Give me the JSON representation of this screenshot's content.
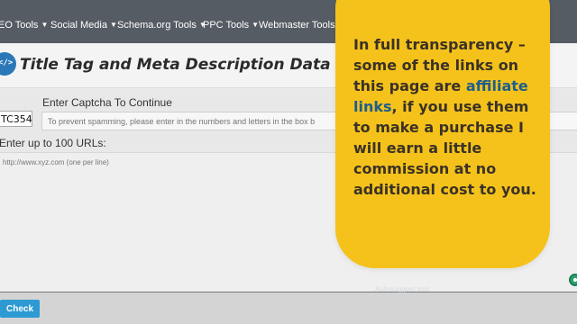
{
  "nav": {
    "items": [
      {
        "label": "EO Tools"
      },
      {
        "label": "Social Media"
      },
      {
        "label": "Schema.org Tools"
      },
      {
        "label": "PPC Tools"
      },
      {
        "label": "Webmaster Tools"
      }
    ],
    "caret_icon": "chevron-down-icon"
  },
  "header": {
    "logo_text": "</>",
    "title": "Title Tag and Meta Description Data for Multip"
  },
  "captcha": {
    "label": "Enter Captcha To Continue",
    "code": "TC354",
    "placeholder": "To prevent spamming, please enter in the numbers and letters in the box b"
  },
  "urls": {
    "label": "Enter up to 100 URLs:",
    "placeholder": "http://www.xyz.com (one per line)"
  },
  "faded_widget_text": "Autosuggest tool",
  "actions": {
    "check_label": "Check"
  },
  "overlay": {
    "text_before": "In full transparency – some of the links on this page are ",
    "link_text": "affiliate links",
    "text_after": ", if you use them to make a purchase I will earn a little commission at no additional cost to you."
  },
  "colors": {
    "nav_bg": "#565c63",
    "overlay_bg": "#f5c21b",
    "link": "#1d5e8c",
    "button": "#2d9ad3",
    "logo": "#2a78b8"
  }
}
